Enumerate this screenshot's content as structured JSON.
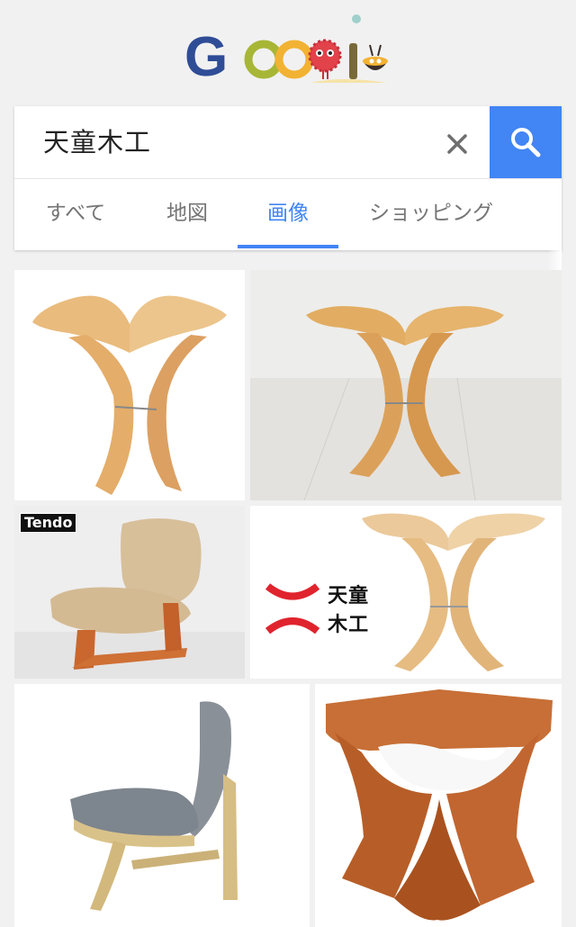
{
  "search": {
    "query": "天童木工"
  },
  "tabs": [
    {
      "label": "すべて"
    },
    {
      "label": "地図"
    },
    {
      "label": "画像"
    },
    {
      "label": "ショッピング"
    }
  ],
  "active_tab": "画像",
  "logo": {
    "text": "Google"
  },
  "images": [
    {
      "name": "butterfly-stool-white-bg"
    },
    {
      "name": "butterfly-stool-floor"
    },
    {
      "name": "low-chair-tendo",
      "overlay_text": "Tendo"
    },
    {
      "name": "butterfly-stool-brand",
      "brand_text": "天童木工"
    },
    {
      "name": "lounge-chair-gray"
    },
    {
      "name": "teak-stool"
    }
  ],
  "colors": {
    "accent": "#4285f4",
    "wood_light": "#e8b878",
    "wood_dark": "#c87a3e"
  }
}
